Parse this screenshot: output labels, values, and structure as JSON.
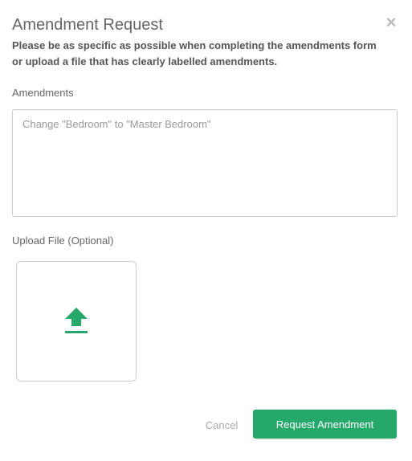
{
  "dialog": {
    "title": "Amendment Request",
    "close_icon": "close-icon",
    "instructions": "Please be as specific as possible when completing the amendments form or upload a file that has clearly labelled amendments."
  },
  "amendments": {
    "label": "Amendments",
    "placeholder": "Change \"Bedroom\" to \"Master Bedroom\"",
    "value": ""
  },
  "upload": {
    "label": "Upload File (Optional)",
    "icon": "upload-icon"
  },
  "actions": {
    "cancel_label": "Cancel",
    "submit_label": "Request Amendment"
  },
  "colors": {
    "accent": "#26a86a",
    "close": "#bbbbbb",
    "border": "#cccccc"
  }
}
